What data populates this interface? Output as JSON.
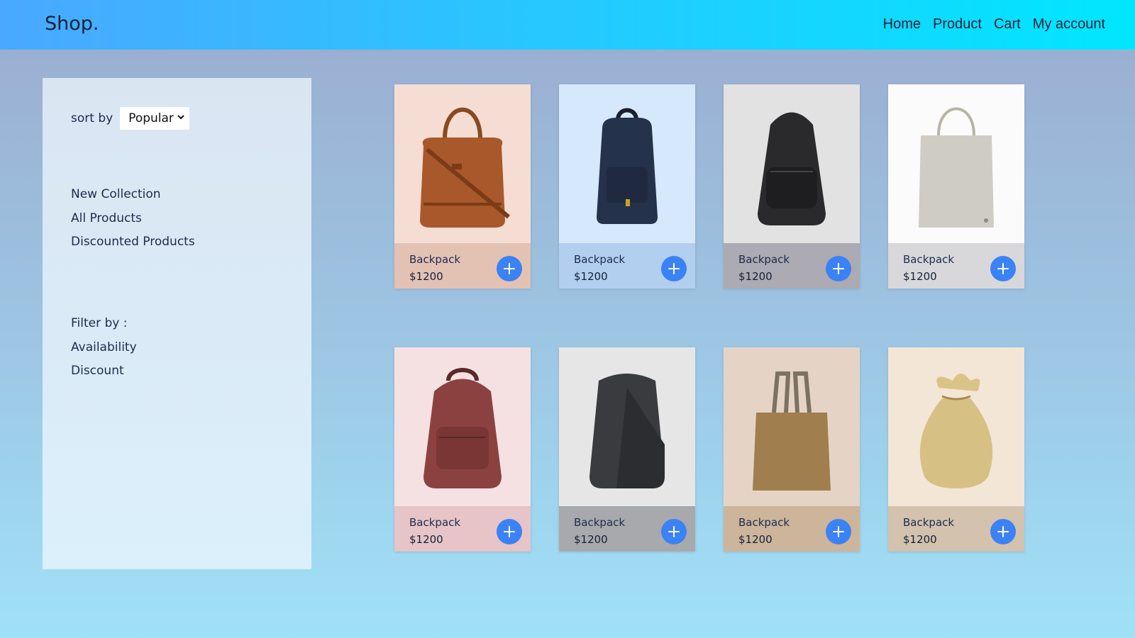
{
  "header": {
    "logo": "Shop.",
    "nav": [
      "Home",
      "Product",
      "Cart",
      "My account"
    ]
  },
  "sidebar": {
    "sort_label": "sort by",
    "sort_value": "Popular",
    "menu": [
      "New Collection",
      "All Products",
      "Discounted Products"
    ],
    "filter_title": "Filter by :",
    "filters": [
      "Availability",
      "Discount"
    ]
  },
  "products": [
    {
      "name": "Backpack",
      "price": "$1200",
      "item": "brown-leather-duffel-bag",
      "img_bg": "#f5ddd4",
      "info_bg": "#e3c2b4"
    },
    {
      "name": "Backpack",
      "price": "$1200",
      "item": "navy-backpack",
      "img_bg": "#d6e8fc",
      "info_bg": "#b2cff0"
    },
    {
      "name": "Backpack",
      "price": "$1200",
      "item": "black-leather-backpack",
      "img_bg": "#e2e2e2",
      "info_bg": "#acaab2"
    },
    {
      "name": "Backpack",
      "price": "$1200",
      "item": "canvas-tote-bag",
      "img_bg": "#fbfbfb",
      "info_bg": "#d8d8da"
    },
    {
      "name": "Backpack",
      "price": "$1200",
      "item": "red-leather-backpack",
      "img_bg": "#f6e1e2",
      "info_bg": "#e7c4c7"
    },
    {
      "name": "Backpack",
      "price": "$1200",
      "item": "grey-anti-theft-backpack",
      "img_bg": "#e6e6e6",
      "info_bg": "#a8a9ac"
    },
    {
      "name": "Backpack",
      "price": "$1200",
      "item": "kraft-tote-bag",
      "img_bg": "#e5d4c6",
      "info_bg": "#ccb59b"
    },
    {
      "name": "Backpack",
      "price": "$1200",
      "item": "burlap-pouch",
      "img_bg": "#f3e6d6",
      "info_bg": "#d3c2ae"
    }
  ],
  "colors": {
    "accent": "#3b82f6",
    "text": "#1d2b4e"
  }
}
